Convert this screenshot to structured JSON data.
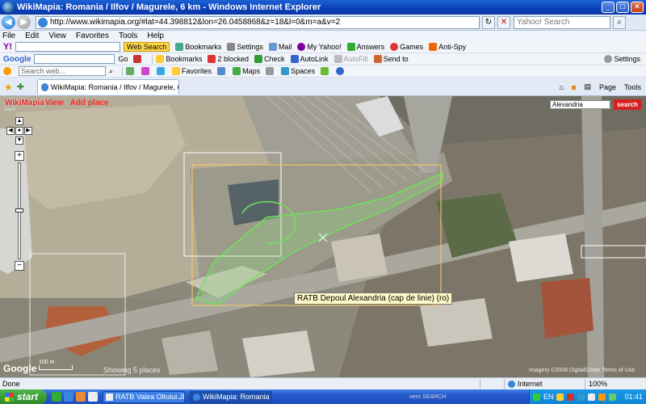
{
  "window": {
    "title": "WikiMapia: Romania / Ilfov / Magurele, 6 km - Windows Internet Explorer"
  },
  "address": {
    "url": "http://www.wikimapia.org/#lat=44.398812&lon=26.0458868&z=18&l=0&m=a&v=2",
    "search_placeholder": "Yahoo! Search"
  },
  "menu": [
    "File",
    "Edit",
    "View",
    "Favorites",
    "Tools",
    "Help"
  ],
  "yahoo_toolbar": {
    "search_btn": "Web Search",
    "items": [
      "Bookmarks",
      "Settings",
      "Mail",
      "My Yahoo!",
      "Answers",
      "Games",
      "Anti-Spy"
    ]
  },
  "google_toolbar": {
    "go": "Go",
    "items": [
      "Bookmarks",
      "2 blocked",
      "Check",
      "AutoLink",
      "AutoFill",
      "Send to"
    ],
    "settings": "Settings"
  },
  "web_toolbar": {
    "search_placeholder": "Search web...",
    "items": [
      "Favorites",
      "Maps",
      "Spaces"
    ]
  },
  "tabs": {
    "active": "WikiMapia: Romania / Ilfov / Magurele, 6 km",
    "tools": [
      "Page",
      "Tools"
    ]
  },
  "map": {
    "brand": "WikiMapia",
    "brand_sub": "earth",
    "nav": [
      "View",
      "Add place"
    ],
    "search_value": "Alexandria",
    "search_btn": "search",
    "tooltip": "RATB Depoul Alexandria (cap de linie) (ro)",
    "scale": "100 m",
    "showing": "Showing 5 places",
    "google": "Google",
    "imagery": "Imagery ©2008 DigitalGlobe  Terms of Use"
  },
  "status": {
    "left": "Done",
    "zone": "Internet",
    "zoom": "100%"
  },
  "taskbar": {
    "start": "start",
    "items": [
      "RATB Valea Oltului.JP...",
      "WikiMapia: Romania /..."
    ],
    "nero": "nero SEARCH",
    "lang": "EN",
    "clock": "01:41"
  }
}
